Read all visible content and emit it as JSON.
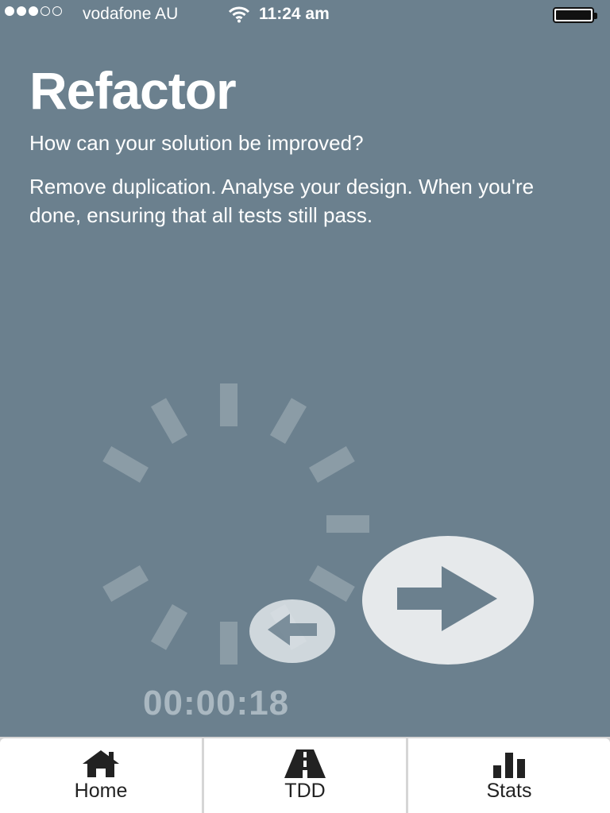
{
  "status_bar": {
    "carrier": "vodafone AU",
    "time": "11:24 am",
    "signal_bars": 3,
    "signal_total": 5
  },
  "page": {
    "title": "Refactor",
    "subtitle": "How can your solution be improved?",
    "description": "Remove duplication. Analyse your design. When you're done, ensuring that all tests still pass."
  },
  "timer": {
    "elapsed": "00:00:18"
  },
  "controls": {
    "back_icon": "arrow-left-icon",
    "next_icon": "arrow-right-icon"
  },
  "tabs": [
    {
      "label": "Home",
      "icon": "home-icon"
    },
    {
      "label": "TDD",
      "icon": "road-icon"
    },
    {
      "label": "Stats",
      "icon": "bar-chart-icon"
    }
  ],
  "colors": {
    "background": "#6b808e",
    "button_fill": "#e6e9eb",
    "arrow": "#6b808e",
    "timer_text": "#aab8c1",
    "tab_bg": "#ffffff"
  }
}
